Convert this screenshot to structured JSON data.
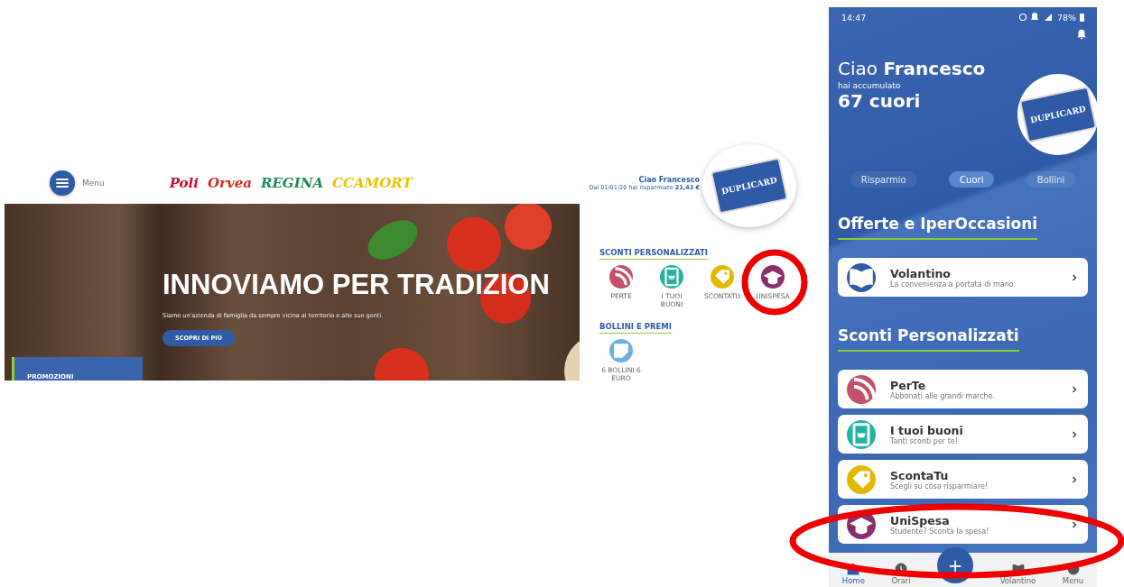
{
  "website": {
    "menu_label": "Menu",
    "brands": [
      {
        "label": "Poli",
        "color": "#c8102e"
      },
      {
        "label": "Orvea",
        "color": "#d52b1e"
      },
      {
        "label": "REGINA",
        "color": "#1f8a5b"
      },
      {
        "label": "CCAMORT",
        "color": "#e8c400"
      }
    ],
    "user": {
      "greeting": "Ciao Francesco",
      "savings": "Dal 01/01/20 hai risparmiato **21,43 €**"
    },
    "card_logo": "DUPLICARD",
    "hero": {
      "title": "INNOVIAMO PER TRADIZION",
      "subtitle": "Siamo un'azienda di famiglia da sempre vicina al territorio e alle sue genti.",
      "button": "SCOPRI DI PIÙ",
      "promo": "PROMOZIONI"
    },
    "sections": [
      {
        "title": "SCONTI PERSONALIZZATI",
        "items": [
          {
            "label": "PERTE",
            "kind": "signal",
            "color": "#c4506a"
          },
          {
            "label": "I TUOI BUONI",
            "kind": "receipt",
            "color": "#1fb5a0"
          },
          {
            "label": "SCONTATU",
            "kind": "tag",
            "color": "#e2b800"
          },
          {
            "label": "UNISPESA",
            "kind": "cap",
            "color": "#8a2f6a"
          }
        ]
      },
      {
        "title": "BOLLINI E PREMI",
        "items": [
          {
            "label": "6 BOLLINI 6 EURO",
            "kind": "sticker",
            "color": "#6fb0e0"
          }
        ]
      }
    ]
  },
  "phone": {
    "status": {
      "time": "14:47",
      "battery": "78%"
    },
    "greeting": "Ciao **Francesco**",
    "subtitle": "hai accumulato",
    "points": "67 cuori",
    "card_logo": "DUPLICARD",
    "tabs": [
      {
        "label": "Risparmio",
        "selected": false
      },
      {
        "label": "Cuori",
        "selected": true
      },
      {
        "label": "Bollini",
        "selected": false
      }
    ],
    "sections": [
      {
        "title": "Offerte e IperOccasioni",
        "items": [
          {
            "title": "Volantino",
            "subtitle": "La convenienza a portata di  mano.",
            "kind": "book",
            "color": "#2f5aa6"
          }
        ]
      },
      {
        "title": "Sconti Personalizzati",
        "items": [
          {
            "title": "PerTe",
            "subtitle": "Abbonati alle grandi marche.",
            "kind": "signal",
            "color": "#c4506a"
          },
          {
            "title": "I tuoi buoni",
            "subtitle": "Tanti sconti per te!",
            "kind": "receipt",
            "color": "#1fb5a0"
          },
          {
            "title": "ScontaTu",
            "subtitle": "Scegli su cosa risparmiare!",
            "kind": "tag",
            "color": "#e2b800"
          },
          {
            "title": "UniSpesa",
            "subtitle": "Studente? Sconta la spesa!",
            "kind": "cap",
            "color": "#8a2f6a"
          }
        ]
      }
    ],
    "nav": [
      {
        "kind": "home",
        "label": "Home",
        "selected": true
      },
      {
        "kind": "clock",
        "label": "Orari",
        "selected": false
      },
      {
        "kind": "fab",
        "label": "+"
      },
      {
        "kind": "book",
        "label": "Volantino",
        "selected": false
      },
      {
        "kind": "dots",
        "label": "Menu",
        "selected": false
      }
    ]
  }
}
